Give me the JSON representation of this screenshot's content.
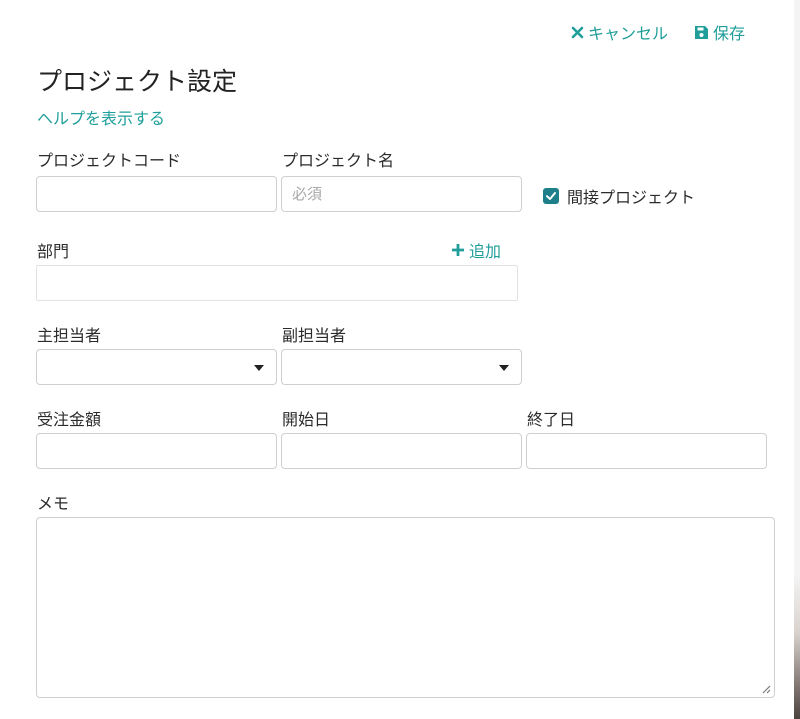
{
  "header": {
    "cancel_label": "キャンセル",
    "save_label": "保存",
    "title": "プロジェクト設定",
    "help_link": "ヘルプを表示する"
  },
  "form": {
    "project_code": {
      "label": "プロジェクトコード",
      "value": "",
      "placeholder": ""
    },
    "project_name": {
      "label": "プロジェクト名",
      "value": "",
      "placeholder": "必須"
    },
    "indirect_project": {
      "label": "間接プロジェクト",
      "checked": true
    },
    "department": {
      "label": "部門",
      "add_label": "追加"
    },
    "main_manager": {
      "label": "主担当者",
      "value": ""
    },
    "sub_manager": {
      "label": "副担当者",
      "value": ""
    },
    "order_amount": {
      "label": "受注金額",
      "value": ""
    },
    "start_date": {
      "label": "開始日",
      "value": ""
    },
    "end_date": {
      "label": "終了日",
      "value": ""
    },
    "memo": {
      "label": "メモ",
      "value": ""
    }
  },
  "colors": {
    "accent": "#1f9e9a",
    "checkbox": "#1e7f8a",
    "border": "#cfcfcf"
  },
  "icons": {
    "cancel": "close-icon",
    "save": "floppy-disk-icon",
    "add": "plus-icon",
    "select": "caret-down-icon"
  }
}
